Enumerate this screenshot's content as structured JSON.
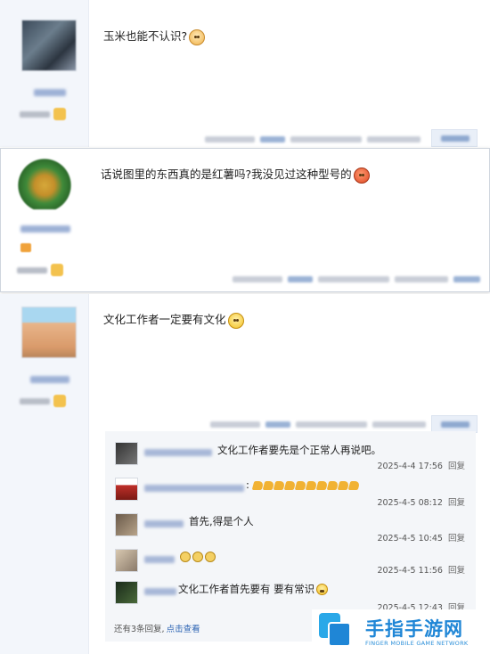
{
  "posts": [
    {
      "text": "玉米也能不认识?",
      "emoji": "sad-face-icon"
    },
    {
      "text": "话说图里的东西真的是红薯吗?我没见过这种型号的",
      "emoji": "angry-face-icon"
    },
    {
      "text": "文化工作者一定要有文化",
      "emoji": "smile-face-icon"
    }
  ],
  "replies": [
    {
      "text": "文化工作者要先是个正常人再说吧。",
      "time": "2025-4-4 17:56",
      "reply_label": "回复"
    },
    {
      "text": ":",
      "time": "2025-4-5 08:12",
      "reply_label": "回复"
    },
    {
      "text": "首先,得是个人",
      "time": "2025-4-5 10:45",
      "reply_label": "回复"
    },
    {
      "text": "",
      "time": "2025-4-5 11:56",
      "reply_label": "回复"
    },
    {
      "text": "文化工作者首先要有 要有常识",
      "time": "2025-4-5 12:43",
      "reply_label": "回复"
    }
  ],
  "more_replies": {
    "count_text": "还有3条回复,",
    "link_text": "点击查看"
  },
  "watermark": {
    "title": "手指手游网",
    "subtitle": "FINGER MOBILE GAME NETWORK"
  },
  "colors": {
    "link": "#2d64b3",
    "brand": "#1f86d6",
    "sidebar": "#f3f6fb",
    "reply_bg": "#f4f6f9"
  }
}
